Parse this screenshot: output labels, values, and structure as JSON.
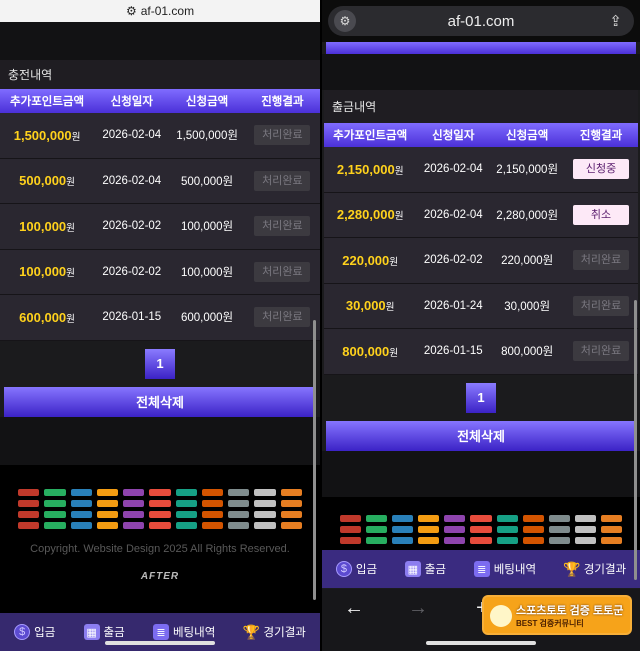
{
  "left": {
    "url": "af-01.com",
    "section_title": "충전내역",
    "columns": [
      "추가포인트금액",
      "신청일자",
      "신청금액",
      "진행결과"
    ],
    "rows": [
      {
        "amount": "1,500,000",
        "unit": "원",
        "date": "2026-02-04",
        "requested": "1,500,000원",
        "status": "처리완료",
        "state": "done"
      },
      {
        "amount": "500,000",
        "unit": "원",
        "date": "2026-02-04",
        "requested": "500,000원",
        "status": "처리완료",
        "state": "done"
      },
      {
        "amount": "100,000",
        "unit": "원",
        "date": "2026-02-02",
        "requested": "100,000원",
        "status": "처리완료",
        "state": "done"
      },
      {
        "amount": "100,000",
        "unit": "원",
        "date": "2026-02-02",
        "requested": "100,000원",
        "status": "처리완료",
        "state": "done"
      },
      {
        "amount": "600,000",
        "unit": "원",
        "date": "2026-01-15",
        "requested": "600,000원",
        "status": "처리완료",
        "state": "done"
      }
    ],
    "page": "1",
    "delete_all": "전체삭제",
    "copyright": "Copyright. Website Design 2025 All Rights Reserved.",
    "footer_logo": "AFTER"
  },
  "right": {
    "url": "af-01.com",
    "section_title": "출금내역",
    "columns": [
      "추가포인트금액",
      "신청일자",
      "신청금액",
      "진행결과"
    ],
    "rows": [
      {
        "amount": "2,150,000",
        "unit": "원",
        "date": "2026-02-04",
        "requested": "2,150,000원",
        "status": "신청중",
        "state": "pending"
      },
      {
        "amount": "2,280,000",
        "unit": "원",
        "date": "2026-02-04",
        "requested": "2,280,000원",
        "status": "취소",
        "state": "pending"
      },
      {
        "amount": "220,000",
        "unit": "원",
        "date": "2026-02-02",
        "requested": "220,000원",
        "status": "처리완료",
        "state": "done"
      },
      {
        "amount": "30,000",
        "unit": "원",
        "date": "2026-01-24",
        "requested": "30,000원",
        "status": "처리완료",
        "state": "done"
      },
      {
        "amount": "800,000",
        "unit": "원",
        "date": "2026-01-15",
        "requested": "800,000원",
        "status": "처리완료",
        "state": "done"
      }
    ],
    "page": "1",
    "delete_all": "전체삭제"
  },
  "nav": {
    "deposit": "입금",
    "withdraw": "출금",
    "betting": "베팅내역",
    "results": "경기결과"
  },
  "watermark": {
    "line1": "스포츠토토 검증 토토군",
    "line2": "BEST 검증커뮤니티"
  },
  "colors": {
    "accent": "#5a3df0",
    "amount": "#ffd21c",
    "nav_bg": "#36296e"
  }
}
